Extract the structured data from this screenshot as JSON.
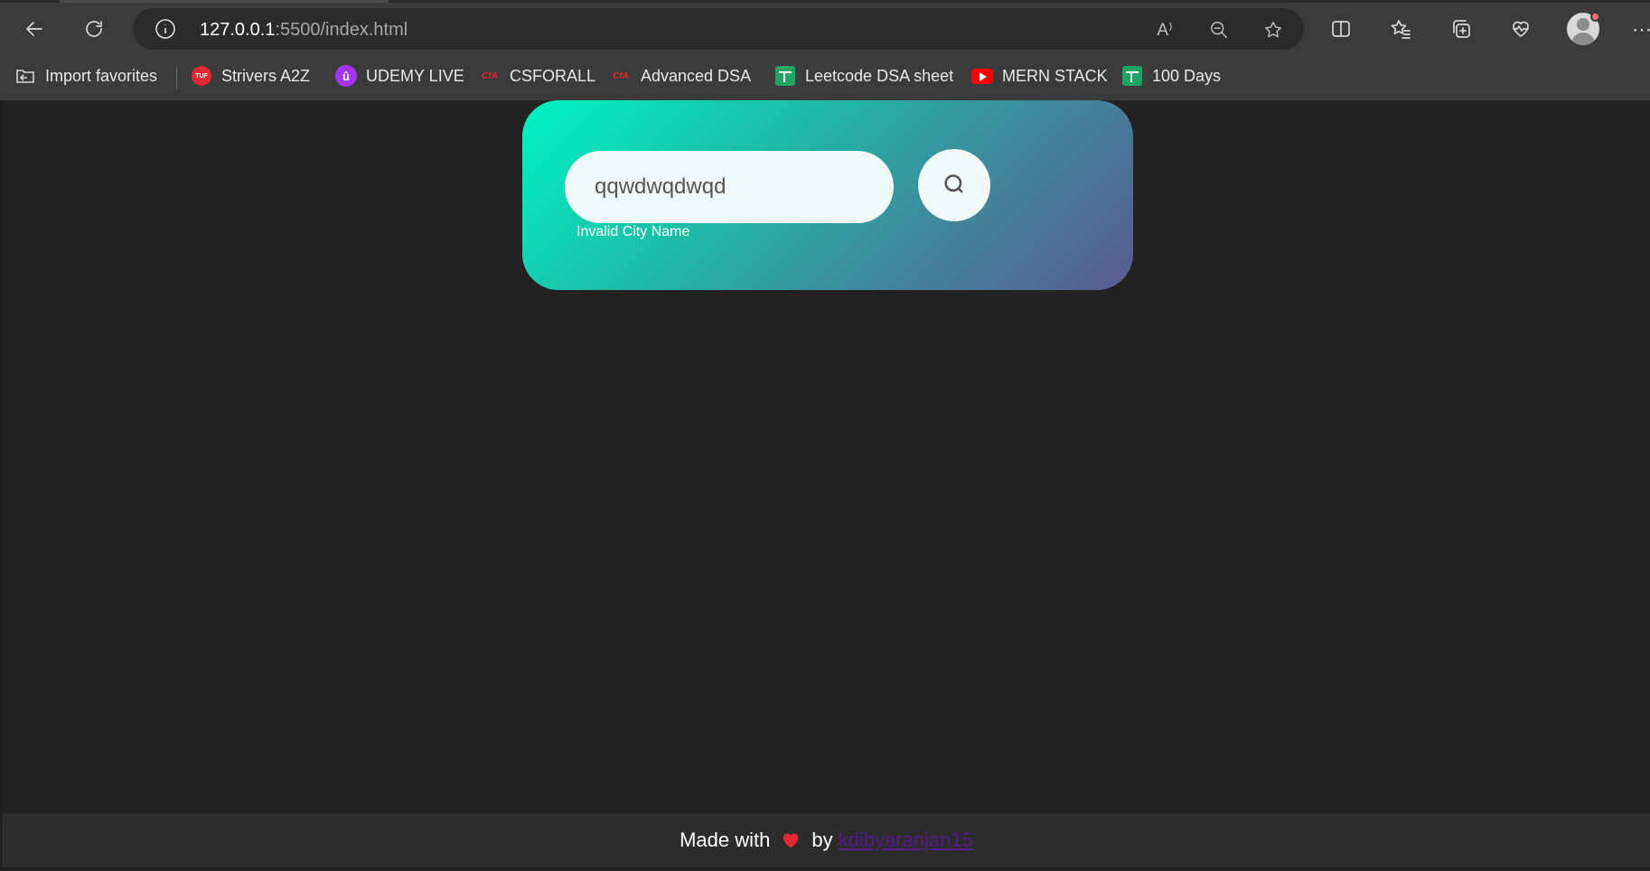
{
  "browser": {
    "url_host": "127.0.0.1",
    "url_path": ":5500/index.html",
    "read_aloud_label": "A⁾"
  },
  "favorites": [
    {
      "label": "Import favorites",
      "icon": "import-favorites-icon"
    },
    {
      "label": "Strivers A2Z",
      "icon": "tuf-icon",
      "badge": "TUF"
    },
    {
      "label": "UDEMY LIVE",
      "icon": "udemy-icon",
      "badge": "û"
    },
    {
      "label": "CSFORALL",
      "icon": "cfa-icon",
      "badge": "CfA"
    },
    {
      "label": "Advanced DSA",
      "icon": "cfa-icon",
      "badge": "CfA"
    },
    {
      "label": "Leetcode DSA sheet",
      "icon": "google-sheets-icon"
    },
    {
      "label": "MERN STACK",
      "icon": "youtube-icon"
    },
    {
      "label": "100 Days",
      "icon": "google-sheets-icon"
    }
  ],
  "app": {
    "search_value": "qqwdwqdwqd",
    "error_text": "Invalid City Name",
    "colors": {
      "card_gradient_start": "#00f5c0",
      "card_gradient_end": "#5a5b8f",
      "input_bg": "#effaf8"
    }
  },
  "footer": {
    "made_with": "Made with",
    "by": "by",
    "author_link": "kdibyaranjan15",
    "heart_icon": "heart-icon"
  }
}
